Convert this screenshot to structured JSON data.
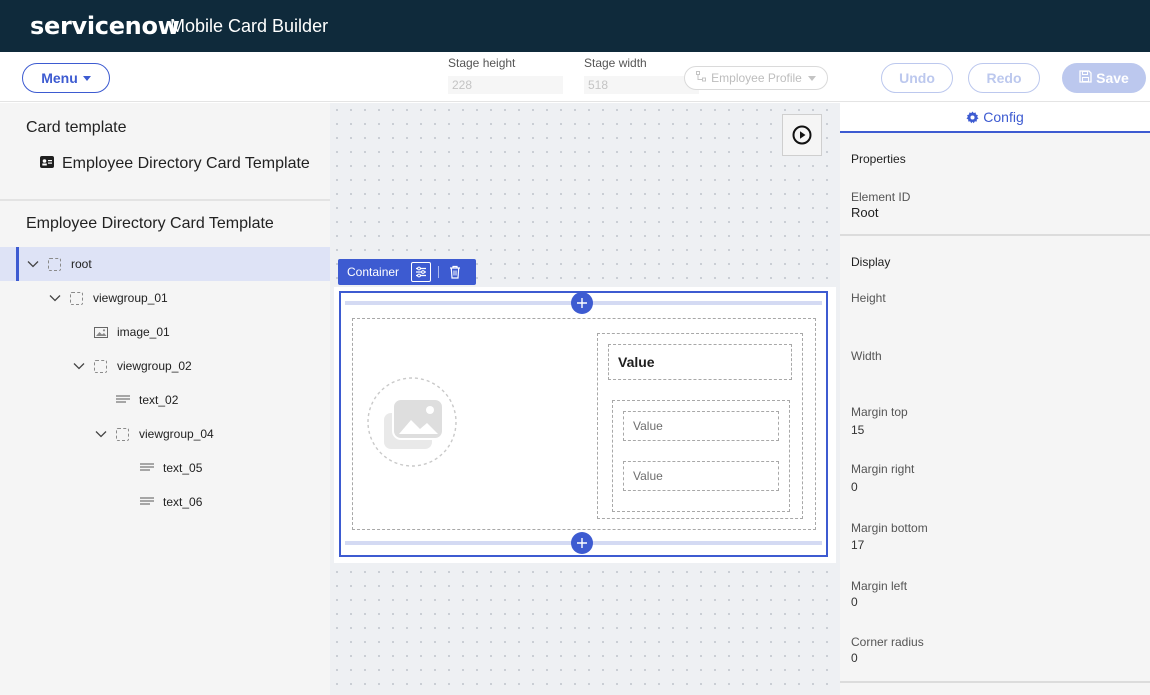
{
  "header": {
    "brand": "servicenow",
    "app_title": "Mobile Card Builder"
  },
  "toolbar": {
    "menu_label": "Menu",
    "stage_height_label": "Stage height",
    "stage_height_value": "228",
    "stage_width_label": "Stage width",
    "stage_width_value": "518",
    "profile_label": "Employee Profile",
    "undo_label": "Undo",
    "redo_label": "Redo",
    "save_label": "Save"
  },
  "left_panel": {
    "card_template_heading": "Card template",
    "template_name": "Employee Directory Card Template",
    "tree_title": "Employee Directory Card Template",
    "tree": [
      {
        "label": "root",
        "depth": 0,
        "type": "container",
        "expanded": true,
        "selected": true
      },
      {
        "label": "viewgroup_01",
        "depth": 1,
        "type": "container",
        "expanded": true
      },
      {
        "label": "image_01",
        "depth": 2,
        "type": "image"
      },
      {
        "label": "viewgroup_02",
        "depth": 2,
        "type": "container",
        "expanded": true
      },
      {
        "label": "text_02",
        "depth": 3,
        "type": "text"
      },
      {
        "label": "viewgroup_04",
        "depth": 3,
        "type": "container",
        "expanded": true
      },
      {
        "label": "text_05",
        "depth": 4,
        "type": "text"
      },
      {
        "label": "text_06",
        "depth": 4,
        "type": "text"
      }
    ]
  },
  "canvas": {
    "toolbar_label": "Container",
    "text_02": "Value",
    "text_05": "Value",
    "text_06": "Value"
  },
  "config": {
    "tab_label": "Config",
    "properties_heading": "Properties",
    "element_id_label": "Element ID",
    "element_id_value": "Root",
    "display_heading": "Display",
    "height_label": "Height",
    "width_label": "Width",
    "margin_top_label": "Margin top",
    "margin_top_value": "15",
    "margin_right_label": "Margin right",
    "margin_right_value": "0",
    "margin_bottom_label": "Margin bottom",
    "margin_bottom_value": "17",
    "margin_left_label": "Margin left",
    "margin_left_value": "0",
    "corner_radius_label": "Corner radius",
    "corner_radius_value": "0"
  },
  "colors": {
    "header_bg": "#0f2a3b",
    "accent": "#3d5bd1",
    "disabled_accent": "#bcc8ee",
    "selection_bg": "#dee3f6"
  },
  "icons": {
    "brand": "servicenow-logo",
    "menu_caret": "caret-down-icon",
    "profile": "hierarchy-icon",
    "save": "floppy-disk-icon",
    "template": "id-card-icon",
    "tree_expand": "chevron-down-icon",
    "tree_container": "dashed-box-icon",
    "tree_image": "image-icon",
    "tree_text": "text-lines-icon",
    "play": "play-circle-icon",
    "settings": "sliders-icon",
    "delete": "trash-icon",
    "add": "plus-circle-icon",
    "config": "gear-icon"
  }
}
